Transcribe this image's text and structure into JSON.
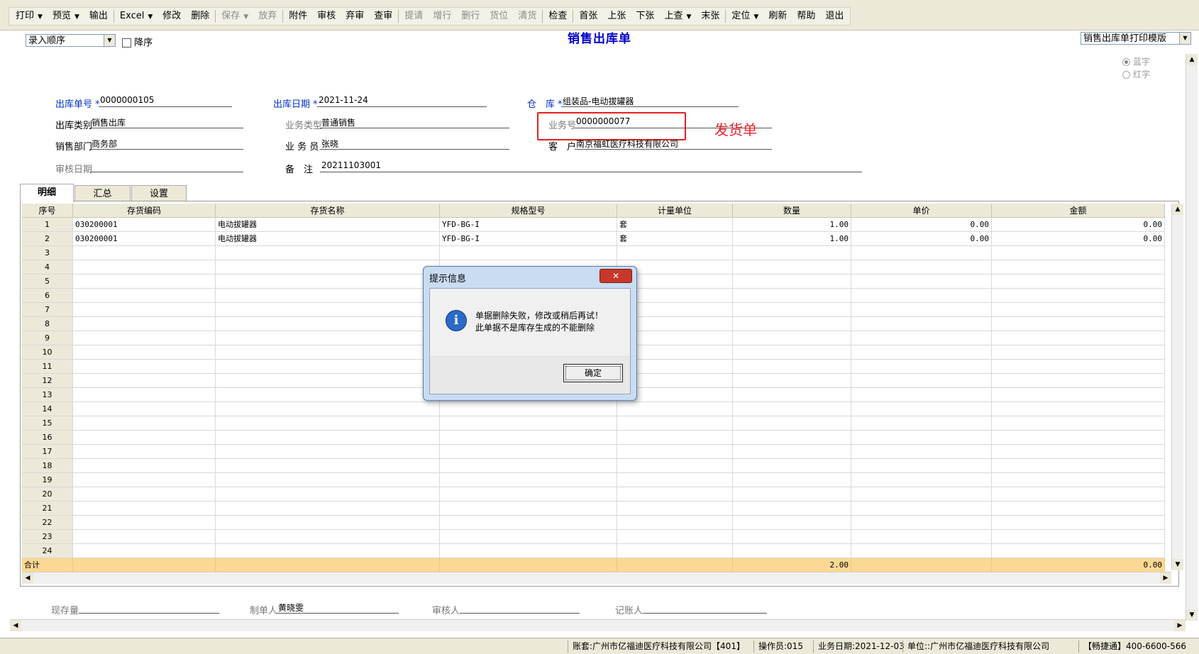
{
  "toolbar": [
    {
      "label": "打印",
      "dropdown": true,
      "disabled": false
    },
    {
      "label": "预览",
      "dropdown": true,
      "disabled": false
    },
    {
      "label": "输出",
      "dropdown": false,
      "disabled": false
    },
    {
      "label": "Excel",
      "dropdown": true,
      "disabled": false
    },
    {
      "label": "修改",
      "dropdown": false,
      "disabled": false
    },
    {
      "label": "删除",
      "dropdown": false,
      "disabled": false
    },
    {
      "label": "保存",
      "dropdown": true,
      "disabled": true
    },
    {
      "label": "放弃",
      "dropdown": false,
      "disabled": true
    },
    {
      "label": "附件",
      "dropdown": false,
      "disabled": false
    },
    {
      "label": "审核",
      "dropdown": false,
      "disabled": false
    },
    {
      "label": "弃审",
      "dropdown": false,
      "disabled": false
    },
    {
      "label": "查审",
      "dropdown": false,
      "disabled": false
    },
    {
      "label": "提请",
      "dropdown": false,
      "disabled": true
    },
    {
      "label": "增行",
      "dropdown": false,
      "disabled": true
    },
    {
      "label": "删行",
      "dropdown": false,
      "disabled": true
    },
    {
      "label": "货位",
      "dropdown": false,
      "disabled": true
    },
    {
      "label": "清货",
      "dropdown": false,
      "disabled": true
    },
    {
      "label": "检查",
      "dropdown": false,
      "disabled": false
    },
    {
      "label": "首张",
      "dropdown": false,
      "disabled": false
    },
    {
      "label": "上张",
      "dropdown": false,
      "disabled": false
    },
    {
      "label": "下张",
      "dropdown": false,
      "disabled": false
    },
    {
      "label": "上查",
      "dropdown": true,
      "disabled": false
    },
    {
      "label": "末张",
      "dropdown": false,
      "disabled": false
    },
    {
      "label": "定位",
      "dropdown": true,
      "disabled": false
    },
    {
      "label": "刷新",
      "dropdown": false,
      "disabled": false
    },
    {
      "label": "帮助",
      "dropdown": false,
      "disabled": false
    },
    {
      "label": "退出",
      "dropdown": false,
      "disabled": false
    }
  ],
  "sort": {
    "value": "录入顺序",
    "desc_label": "降序"
  },
  "title": "销售出库单",
  "template": "销售出库单打印模版",
  "radio": {
    "blue": "蓝字",
    "red": "红字"
  },
  "form": {
    "doc_no": {
      "label": "出库单号",
      "value": "0000000105"
    },
    "out_date": {
      "label": "出库日期",
      "value": "2021-11-24"
    },
    "warehouse": {
      "label": "仓　库",
      "value": "组装品-电动拔罐器"
    },
    "out_type": {
      "label": "出库类别",
      "value": "销售出库"
    },
    "biz_type": {
      "label": "业务类型",
      "value": "普通销售"
    },
    "biz_no": {
      "label": "业务号",
      "value": "0000000077"
    },
    "sales_dept": {
      "label": "销售部门",
      "value": "商务部"
    },
    "salesman": {
      "label": "业 务 员",
      "value": "张晓"
    },
    "customer": {
      "label": "客　户",
      "value": "南京福虹医疗科技有限公司"
    },
    "audit_date": {
      "label": "审核日期",
      "value": ""
    },
    "remark": {
      "label": "备　注",
      "value": "20211103001"
    }
  },
  "annotation": "发货单",
  "tabs": [
    "明细",
    "汇总",
    "设置"
  ],
  "grid": {
    "headers": [
      "序号",
      "存货编码",
      "存货名称",
      "规格型号",
      "计量单位",
      "数量",
      "单价",
      "金额"
    ],
    "rows": [
      {
        "no": "1",
        "code": "030200001",
        "name": "电动拔罐器",
        "spec": "YFD-BG-I",
        "unit": "套",
        "qty": "1.00",
        "price": "0.00",
        "amount": "0.00"
      },
      {
        "no": "2",
        "code": "030200001",
        "name": "电动拔罐器",
        "spec": "YFD-BG-I",
        "unit": "套",
        "qty": "1.00",
        "price": "0.00",
        "amount": "0.00"
      },
      {
        "no": "3"
      },
      {
        "no": "4"
      },
      {
        "no": "5"
      },
      {
        "no": "6"
      },
      {
        "no": "7"
      },
      {
        "no": "8"
      },
      {
        "no": "9"
      },
      {
        "no": "10"
      },
      {
        "no": "11"
      },
      {
        "no": "12"
      },
      {
        "no": "13"
      },
      {
        "no": "14"
      },
      {
        "no": "15"
      },
      {
        "no": "16"
      },
      {
        "no": "17"
      },
      {
        "no": "18"
      },
      {
        "no": "19"
      },
      {
        "no": "20"
      },
      {
        "no": "21"
      },
      {
        "no": "22"
      },
      {
        "no": "23"
      },
      {
        "no": "24"
      }
    ],
    "total": {
      "label": "合计",
      "qty": "2.00",
      "amount": "0.00"
    }
  },
  "footer": {
    "stock": {
      "label": "现存量",
      "value": ""
    },
    "maker": {
      "label": "制单人",
      "value": "黄晓雯"
    },
    "auditor": {
      "label": "审核人",
      "value": ""
    },
    "bookkeeper": {
      "label": "记账人",
      "value": ""
    }
  },
  "status": {
    "account": "账套:广州市亿福迪医疗科技有限公司【401】",
    "operator": "操作员:015",
    "biz_date": "业务日期:2021-12-03",
    "unit": "单位::广州市亿福迪医疗科技有限公司",
    "hotline": "【畅捷通】400-6600-566"
  },
  "dialog": {
    "title": "提示信息",
    "line1": "单据删除失败，修改或稍后再试！",
    "line2": "此单据不是库存生成的不能删除",
    "ok": "确定"
  }
}
